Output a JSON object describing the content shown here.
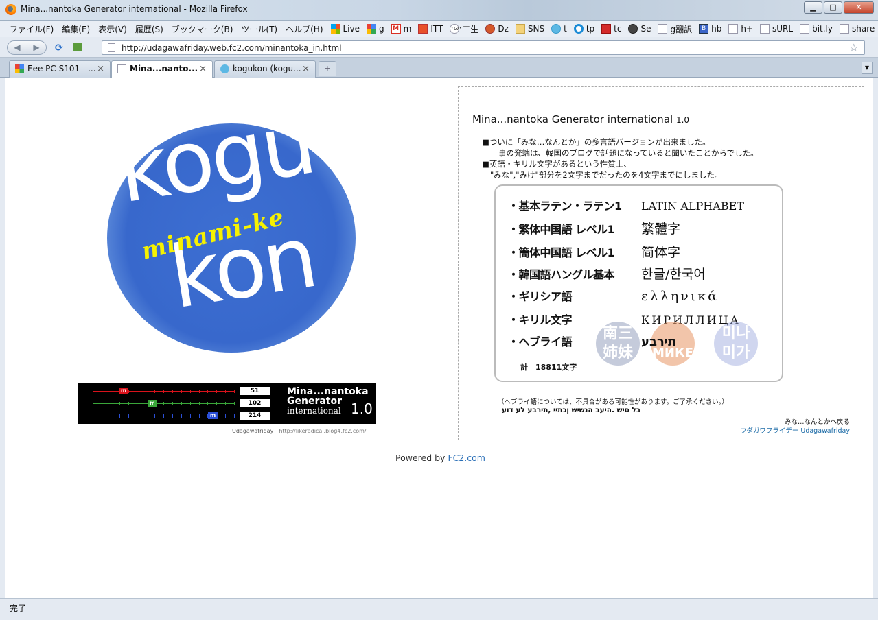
{
  "window": {
    "title": "Mina...nantoka Generator international - Mozilla Firefox",
    "minimize": "▁",
    "maximize": "□",
    "close": "✕"
  },
  "menubar": {
    "items": [
      "ファイル(F)",
      "編集(E)",
      "表示(V)",
      "履歴(S)",
      "ブックマーク(B)",
      "ツール(T)",
      "ヘルプ(H)"
    ],
    "bookmarks": [
      "Live",
      "g",
      "m",
      "ITT",
      "二生",
      "Dz",
      "SNS",
      "t",
      "tp",
      "tc",
      "Se",
      "g翻訳",
      "hb",
      "h+",
      "sURL",
      "bit.ly",
      "share"
    ]
  },
  "navbar": {
    "url": "http://udagawafriday.web.fc2.com/minantoka_in.html"
  },
  "tabs": [
    {
      "label": "Eee PC S101 - ...",
      "icon": "google-icon"
    },
    {
      "label": "Mina...nanto...",
      "icon": "page-icon",
      "active": true
    },
    {
      "label": "kogukon (kogu...",
      "icon": "twitter-icon"
    }
  ],
  "logo": {
    "line1": "kogu",
    "line2": "kon",
    "tagline": "minami-ke"
  },
  "banner": {
    "marker": "m",
    "values": [
      "51",
      "102",
      "214"
    ],
    "fractions": [
      0.22,
      0.42,
      0.85
    ],
    "colors": [
      "#d8121b",
      "#3aa63a",
      "#2b4fd6"
    ],
    "gen_line1": "Mina...nantoka",
    "gen_line2": "Generator",
    "gen_line3": "international",
    "version": "1.0",
    "author": "Udagawafriday",
    "site": "http://likeradical.blog4.fc2.com/"
  },
  "panel": {
    "title": "Mina...nantoka Generator international",
    "version": "1.0",
    "desc": [
      "■ついに「みな…なんとか」の多言語バージョンが出来ました。",
      "事の発端は、韓国のブログで話題になっていると聞いたことからでした。",
      "■英語・キリル文字があるという性質上、",
      "\"みな\",\"みけ\"部分を2文字までだったのを4文字までにしました。"
    ],
    "languages": [
      {
        "name": "・基本ラテン・ラテン1",
        "sample": "LATIN ALPHABET"
      },
      {
        "name": "・繁体中国語 レベル1",
        "sample": "繁體字"
      },
      {
        "name": "・簡体中国語 レベル1",
        "sample": "简体字"
      },
      {
        "name": "・韓国語ハングル基本",
        "sample": "한글/한국어"
      },
      {
        "name": "・ギリシア語",
        "sample": "ελληνικά"
      },
      {
        "name": "・キリル文字",
        "sample": "КИРИЛЛИЦА"
      },
      {
        "name": "・ヘブライ語",
        "sample": "תירבע"
      }
    ],
    "total": "計　18811文字",
    "badges": [
      "南三\n姉妹",
      "МИКЕ",
      "미나\n미가"
    ],
    "note_ja": "（ヘブライ語については、不具合がある可能性があります。ご了承ください。）",
    "note_he": "בל סיש .היעב הנשיש ןכתיי ,תירבע לע דוע",
    "back_link": "みな…なんとかへ戻る",
    "author_link": "ウダガワフライデー Udagawafriday"
  },
  "footer": {
    "powered_prefix": "Powered by",
    "powered_link": "FC2.com"
  },
  "status": {
    "text": "完了"
  }
}
